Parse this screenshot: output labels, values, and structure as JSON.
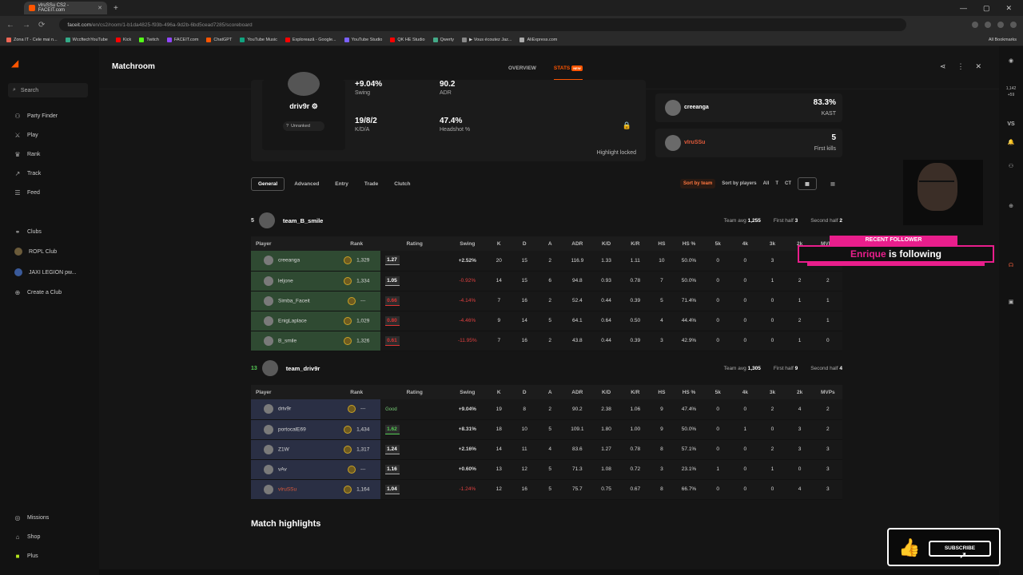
{
  "browser": {
    "tab_title": "vIruSSu CS2 - FACEIT.com",
    "url_host": "faceit.com",
    "url_path": "/en/cs2/room/1-b1da4825-f93b-496a-9d2b-6bd5cead7285/scoreboard",
    "bookmarks": [
      "Zona IT - Cele mai n...",
      "WccftechYouTube",
      "Kick",
      "Twitch",
      "FACEIT.com",
      "ChatGPT",
      "YouTube Music",
      "Explorează - Google...",
      "YouTube Studio",
      "QK HE Studio",
      "Qwerty",
      "▶ Vous écoutez Jaz...",
      "AliExpress.com"
    ],
    "all_bookmarks": "All Bookmarks"
  },
  "sidebar": {
    "search_placeholder": "Search",
    "items": [
      "Party Finder",
      "Play",
      "Rank",
      "Track",
      "Feed"
    ],
    "clubs_label": "Clubs",
    "clubs": [
      "ROPL Club",
      "JAXI LEGION pw..."
    ],
    "create_club": "Create a Club",
    "bottom": [
      "Missions",
      "Shop",
      "Plus"
    ]
  },
  "header": {
    "title": "Matchroom",
    "tabs": [
      "OVERVIEW",
      "STATS"
    ],
    "new_badge": "NEW"
  },
  "profile": {
    "name": "driv9r",
    "rank": "Unranked",
    "swing": "+9.04%",
    "swing_label": "Swing",
    "adr": "90.2",
    "adr_label": "ADR",
    "kda": "19/8/2",
    "kda_label": "K/D/A",
    "hs": "47.4%",
    "hs_label": "Headshot %",
    "highlight": "Highlight locked"
  },
  "mini_cards": [
    {
      "name": "creeanga",
      "value": "83.3%",
      "label": "KAST"
    },
    {
      "name": "vIruSSu",
      "value": "5",
      "label": "First kills"
    }
  ],
  "filters": {
    "tabs": [
      "General",
      "Advanced",
      "Entry",
      "Trade",
      "Clutch"
    ],
    "sort_team": "Sort by team",
    "sort_players": "Sort by players",
    "sides": [
      "All",
      "T",
      "CT"
    ]
  },
  "columns": [
    "Player",
    "Rank",
    "Rating",
    "Swing",
    "K",
    "D",
    "A",
    "ADR",
    "K/D",
    "K/R",
    "HS",
    "HS %",
    "5k",
    "4k",
    "3k",
    "2k",
    "MVPs"
  ],
  "team1": {
    "score": "5",
    "name": "team_B_smile",
    "avg_label": "Team avg",
    "avg": "1,255",
    "first_half_label": "First half",
    "first_half": "3",
    "second_half_label": "Second half",
    "second_half": "2",
    "rows": [
      {
        "player": "creeanga",
        "rank": "1,329",
        "rating": "1.27",
        "swing": "+2.52%",
        "k": "20",
        "d": "15",
        "a": "2",
        "adr": "116.9",
        "kd": "1.33",
        "kr": "1.11",
        "hs": "10",
        "hsp": "50.0%",
        "k5": "0",
        "k4": "0",
        "k3": "3",
        "k2": "2",
        "mvps": "2"
      },
      {
        "player": "leljone",
        "rank": "1,334",
        "rating": "1.05",
        "swing": "-0.92%",
        "k": "14",
        "d": "15",
        "a": "6",
        "adr": "94.8",
        "kd": "0.93",
        "kr": "0.78",
        "hs": "7",
        "hsp": "50.0%",
        "k5": "0",
        "k4": "0",
        "k3": "1",
        "k2": "2",
        "mvps": "2"
      },
      {
        "player": "Simba_Faceit",
        "rank": "---",
        "rating": "0.66",
        "swing": "-4.14%",
        "k": "7",
        "d": "16",
        "a": "2",
        "adr": "52.4",
        "kd": "0.44",
        "kr": "0.39",
        "hs": "5",
        "hsp": "71.4%",
        "k5": "0",
        "k4": "0",
        "k3": "0",
        "k2": "1",
        "mvps": "1"
      },
      {
        "player": "EnigLaplace",
        "rank": "1,029",
        "rating": "0.80",
        "swing": "-4.46%",
        "k": "9",
        "d": "14",
        "a": "5",
        "adr": "64.1",
        "kd": "0.64",
        "kr": "0.50",
        "hs": "4",
        "hsp": "44.4%",
        "k5": "0",
        "k4": "0",
        "k3": "0",
        "k2": "2",
        "mvps": "1"
      },
      {
        "player": "B_smile",
        "rank": "1,326",
        "rating": "0.61",
        "swing": "-11.95%",
        "k": "7",
        "d": "16",
        "a": "2",
        "adr": "43.8",
        "kd": "0.44",
        "kr": "0.39",
        "hs": "3",
        "hsp": "42.9%",
        "k5": "0",
        "k4": "0",
        "k3": "0",
        "k2": "1",
        "mvps": "0"
      }
    ]
  },
  "team2": {
    "score": "13",
    "name": "team_driv9r",
    "avg_label": "Team avg",
    "avg": "1,305",
    "first_half_label": "First half",
    "first_half": "9",
    "second_half_label": "Second half",
    "second_half": "4",
    "rows": [
      {
        "player": "driv9r",
        "rank": "---",
        "rating": "Good",
        "swing": "+9.04%",
        "k": "19",
        "d": "8",
        "a": "2",
        "adr": "90.2",
        "kd": "2.38",
        "kr": "1.06",
        "hs": "9",
        "hsp": "47.4%",
        "k5": "0",
        "k4": "0",
        "k3": "2",
        "k2": "4",
        "mvps": "2"
      },
      {
        "player": "portocalE69",
        "rank": "1,434",
        "rating": "1.62",
        "swing": "+8.31%",
        "k": "18",
        "d": "10",
        "a": "5",
        "adr": "109.1",
        "kd": "1.80",
        "kr": "1.00",
        "hs": "9",
        "hsp": "50.0%",
        "k5": "0",
        "k4": "1",
        "k3": "0",
        "k2": "3",
        "mvps": "2"
      },
      {
        "player": "Z1W",
        "rank": "1,317",
        "rating": "1.24",
        "swing": "+2.16%",
        "k": "14",
        "d": "11",
        "a": "4",
        "adr": "83.6",
        "kd": "1.27",
        "kr": "0.78",
        "hs": "8",
        "hsp": "57.1%",
        "k5": "0",
        "k4": "0",
        "k3": "2",
        "k2": "3",
        "mvps": "3"
      },
      {
        "player": "vAv",
        "rank": "---",
        "rating": "1.16",
        "swing": "+0.60%",
        "k": "13",
        "d": "12",
        "a": "5",
        "adr": "71.3",
        "kd": "1.08",
        "kr": "0.72",
        "hs": "3",
        "hsp": "23.1%",
        "k5": "1",
        "k4": "0",
        "k3": "1",
        "k2": "0",
        "mvps": "3"
      },
      {
        "player": "vIruSSu",
        "rank": "1,164",
        "rating": "1.04",
        "swing": "-1.24%",
        "k": "12",
        "d": "16",
        "a": "5",
        "adr": "75.7",
        "kd": "0.75",
        "kr": "0.67",
        "hs": "8",
        "hsp": "66.7%",
        "k5": "0",
        "k4": "0",
        "k3": "0",
        "k2": "4",
        "mvps": "3"
      }
    ]
  },
  "match_highlights": "Match highlights",
  "overlay": {
    "follower_title": "RECENT FOLLOWER",
    "follower_name": "Enrique",
    "follower_text": "is following",
    "subscribe": "SUBSCRIBE"
  },
  "right_rail": {
    "count1": "1,142",
    "count2": "+59",
    "vs": "VS"
  }
}
